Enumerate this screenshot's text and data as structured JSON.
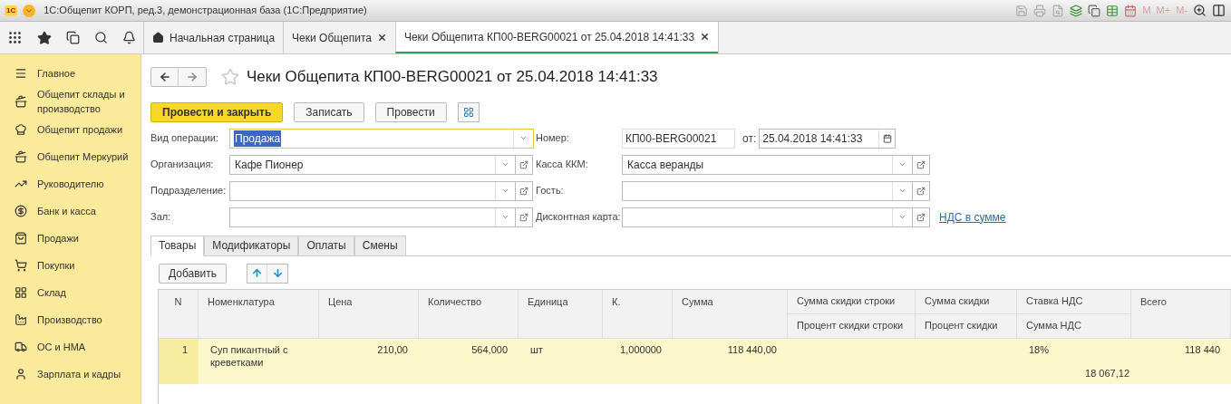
{
  "title_bar": {
    "logo": "1С",
    "title": "1С:Общепит КОРП, ред.3, демонстрационная база  (1С:Предприятие)",
    "memory_keys": [
      "M",
      "M+",
      "M-"
    ]
  },
  "open_tabs": [
    {
      "label": "Начальная страница",
      "kind": "home",
      "selected": false,
      "closable": false
    },
    {
      "label": "Чеки Общепита",
      "kind": "doc",
      "selected": false,
      "closable": true
    },
    {
      "label": "Чеки Общепита КП00-BERG00021 от 25.04.2018 14:41:33",
      "kind": "doc",
      "selected": true,
      "closable": true
    }
  ],
  "sidebar": {
    "items": [
      {
        "label": "Главное"
      },
      {
        "label": "Общепит склады и производство"
      },
      {
        "label": "Общепит продажи"
      },
      {
        "label": "Общепит Меркурий"
      },
      {
        "label": "Руководителю"
      },
      {
        "label": "Банк и касса"
      },
      {
        "label": "Продажи"
      },
      {
        "label": "Покупки"
      },
      {
        "label": "Склад"
      },
      {
        "label": "Производство"
      },
      {
        "label": "ОС и НМА"
      },
      {
        "label": "Зарплата и кадры"
      }
    ]
  },
  "document": {
    "title": "Чеки Общепита КП00-BERG00021 от 25.04.2018 14:41:33",
    "buttons": [
      {
        "label": "Провести и закрыть",
        "kind": "primary"
      },
      {
        "label": "Записать",
        "kind": "normal"
      },
      {
        "label": "Провести",
        "kind": "normal"
      }
    ],
    "left_fields": [
      {
        "label": "Вид операции:",
        "value": "Продажа",
        "focused": true
      },
      {
        "label": "Организация:",
        "value": "Кафе Пионер",
        "focused": false
      },
      {
        "label": "Подразделение:",
        "focused": false
      },
      {
        "label": "Зал:",
        "focused": false
      }
    ],
    "number": {
      "label": "Номер:",
      "value": "КП00-BERG00021",
      "date_label": "от:",
      "date": "25.04.2018 14:41:33"
    },
    "right_fields": [
      {
        "label": "Касса ККМ:",
        "value": "Касса веранды"
      },
      {
        "label": "Гость:"
      },
      {
        "label": "Дисконтная карта:"
      }
    ],
    "vat_link": "НДС в сумме",
    "tabs": [
      {
        "label": "Товары",
        "selected": true
      },
      {
        "label": "Модификаторы",
        "selected": false
      },
      {
        "label": "Оплаты",
        "selected": false
      },
      {
        "label": "Смены",
        "selected": false
      }
    ],
    "add_button": "Добавить",
    "table": {
      "columns": [
        {
          "label": "N"
        },
        {
          "label": "Номенклатура"
        },
        {
          "label": "Цена"
        },
        {
          "label": "Количество"
        },
        {
          "label": "Единица"
        },
        {
          "label": "К."
        },
        {
          "label": "Сумма"
        },
        {
          "label": "Сумма скидки строки",
          "sublabel": "Процент скидки строки"
        },
        {
          "label": "Сумма скидки",
          "sublabel": "Процент скидки"
        },
        {
          "label": "Ставка НДС",
          "sublabel": "Сумма НДС"
        },
        {
          "label": "Всего"
        }
      ],
      "rows": [
        {
          "selected": true,
          "cells": [
            {
              "text": "1"
            },
            {
              "text": "Суп пикантный с креветками"
            },
            {
              "text": "210,00"
            },
            {
              "text": "564,000"
            },
            {
              "text": "шт"
            },
            {
              "text": "1,000000"
            },
            {
              "text": "118 440,00"
            },
            {},
            {},
            {
              "text": "18%",
              "sub": "18 067,12"
            },
            {
              "text": "118 440"
            }
          ]
        }
      ]
    }
  }
}
